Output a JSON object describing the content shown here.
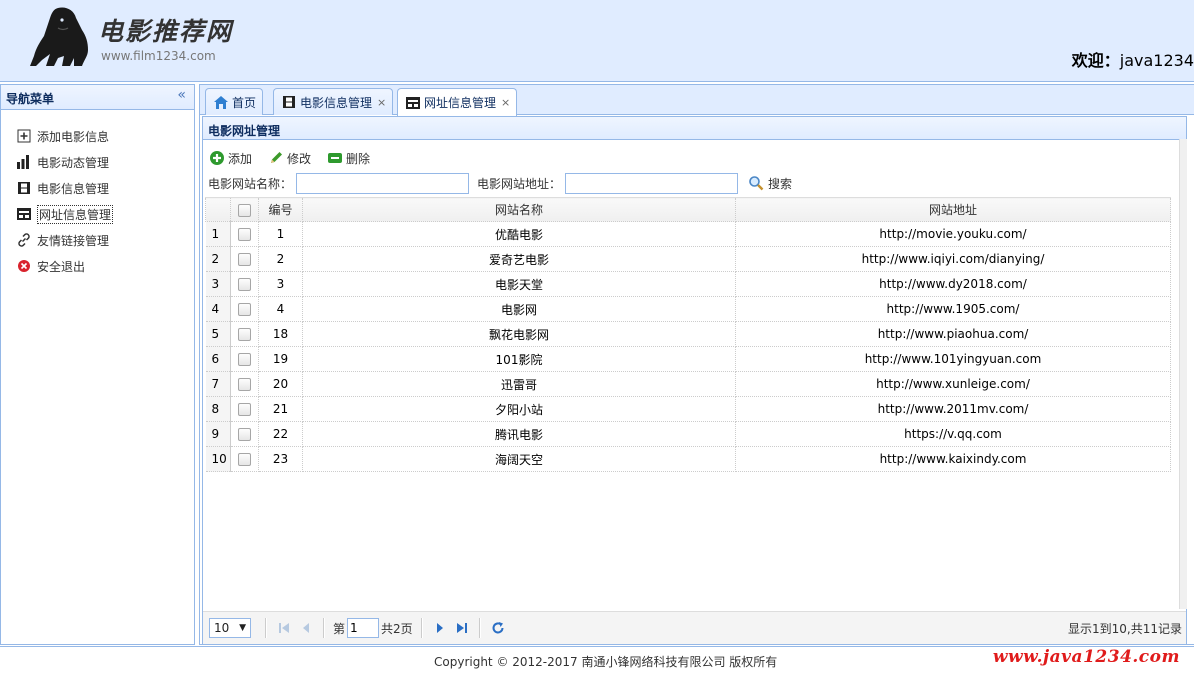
{
  "header": {
    "brand_title": "电影推荐网",
    "brand_url": "www.film1234.com",
    "welcome_label": "欢迎：",
    "username": "java1234"
  },
  "sidebar": {
    "title": "导航菜单",
    "items": [
      {
        "label": "添加电影信息",
        "icon": "add-icon"
      },
      {
        "label": "电影动态管理",
        "icon": "bar-chart-icon"
      },
      {
        "label": "电影信息管理",
        "icon": "film-icon"
      },
      {
        "label": "网址信息管理",
        "icon": "website-icon",
        "selected": true
      },
      {
        "label": "友情链接管理",
        "icon": "link-icon"
      },
      {
        "label": "安全退出",
        "icon": "exit-icon"
      }
    ]
  },
  "tabs": [
    {
      "label": "首页",
      "icon": "home-icon",
      "closable": false
    },
    {
      "label": "电影信息管理",
      "icon": "film-icon",
      "closable": true
    },
    {
      "label": "网址信息管理",
      "icon": "website-icon",
      "closable": true,
      "active": true
    }
  ],
  "panel": {
    "title": "电影网址管理",
    "toolbar": {
      "add": "添加",
      "edit": "修改",
      "delete": "删除"
    },
    "search": {
      "name_label": "电影网站名称：",
      "name_value": "",
      "url_label": "电影网站地址：",
      "url_value": "",
      "search_label": "搜索"
    }
  },
  "grid": {
    "columns": {
      "id": "编号",
      "name": "网站名称",
      "url": "网站地址"
    },
    "rows": [
      {
        "n": "1",
        "id": "1",
        "name": "优酷电影",
        "url": "http://movie.youku.com/"
      },
      {
        "n": "2",
        "id": "2",
        "name": "爱奇艺电影",
        "url": "http://www.iqiyi.com/dianying/"
      },
      {
        "n": "3",
        "id": "3",
        "name": "电影天堂",
        "url": "http://www.dy2018.com/"
      },
      {
        "n": "4",
        "id": "4",
        "name": "电影网",
        "url": "http://www.1905.com/"
      },
      {
        "n": "5",
        "id": "18",
        "name": "飘花电影网",
        "url": "http://www.piaohua.com/"
      },
      {
        "n": "6",
        "id": "19",
        "name": "101影院",
        "url": "http://www.101yingyuan.com"
      },
      {
        "n": "7",
        "id": "20",
        "name": "迅雷哥",
        "url": "http://www.xunleige.com/"
      },
      {
        "n": "8",
        "id": "21",
        "name": "夕阳小站",
        "url": "http://www.2011mv.com/"
      },
      {
        "n": "9",
        "id": "22",
        "name": "腾讯电影",
        "url": "https://v.qq.com"
      },
      {
        "n": "10",
        "id": "23",
        "name": "海阔天空",
        "url": "http://www.kaixindy.com"
      }
    ]
  },
  "pager": {
    "page_size": "10",
    "page_prefix": "第",
    "page_value": "1",
    "page_total": "共2页",
    "info": "显示1到10,共11记录"
  },
  "footer": {
    "copyright": "Copyright © 2012-2017 南通小锋网络科技有限公司 版权所有",
    "watermark": "www.java1234.com"
  }
}
